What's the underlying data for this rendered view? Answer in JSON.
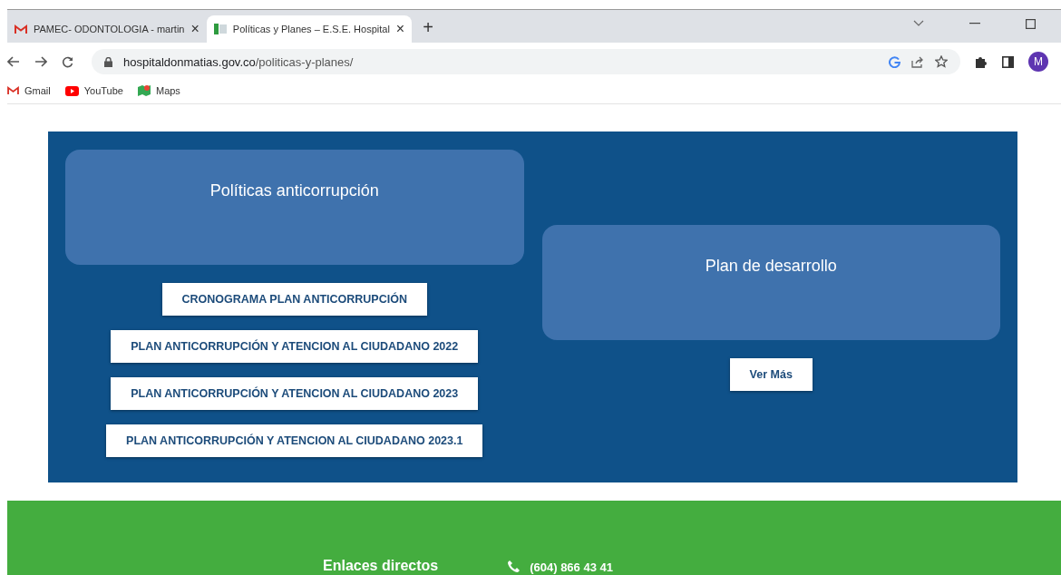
{
  "tabs": [
    {
      "title": "PAMEC- ODONTOLOGIA - martin",
      "close": "×",
      "selected": false
    },
    {
      "title": "Políticas y Planes – E.S.E. Hospital",
      "close": "×",
      "selected": true
    }
  ],
  "new_tab": "+",
  "address": {
    "host": "hospitaldonmatias.gov.co",
    "path": "/politicas-y-planes/"
  },
  "profile": "M",
  "bookmarks": [
    {
      "label": "Gmail"
    },
    {
      "label": "YouTube"
    },
    {
      "label": "Maps"
    }
  ],
  "columns": [
    {
      "card": "Políticas anticorrupción",
      "buttons": [
        "CRONOGRAMA PLAN ANTICORRUPCIÓN",
        "PLAN ANTICORRUPCIÓN Y ATENCION AL CIUDADANO 2022",
        "PLAN ANTICORRUPCIÓN Y ATENCION AL CIUDADANO 2023",
        "PLAN ANTICORRUPCIÓN Y ATENCION AL CIUDADANO 2023.1"
      ]
    },
    {
      "card": "Plan de desarrollo",
      "buttons": [
        "Ver Más"
      ]
    }
  ],
  "footer": {
    "heading": "Enlaces directos",
    "phone": "(604) 866 43 41"
  }
}
